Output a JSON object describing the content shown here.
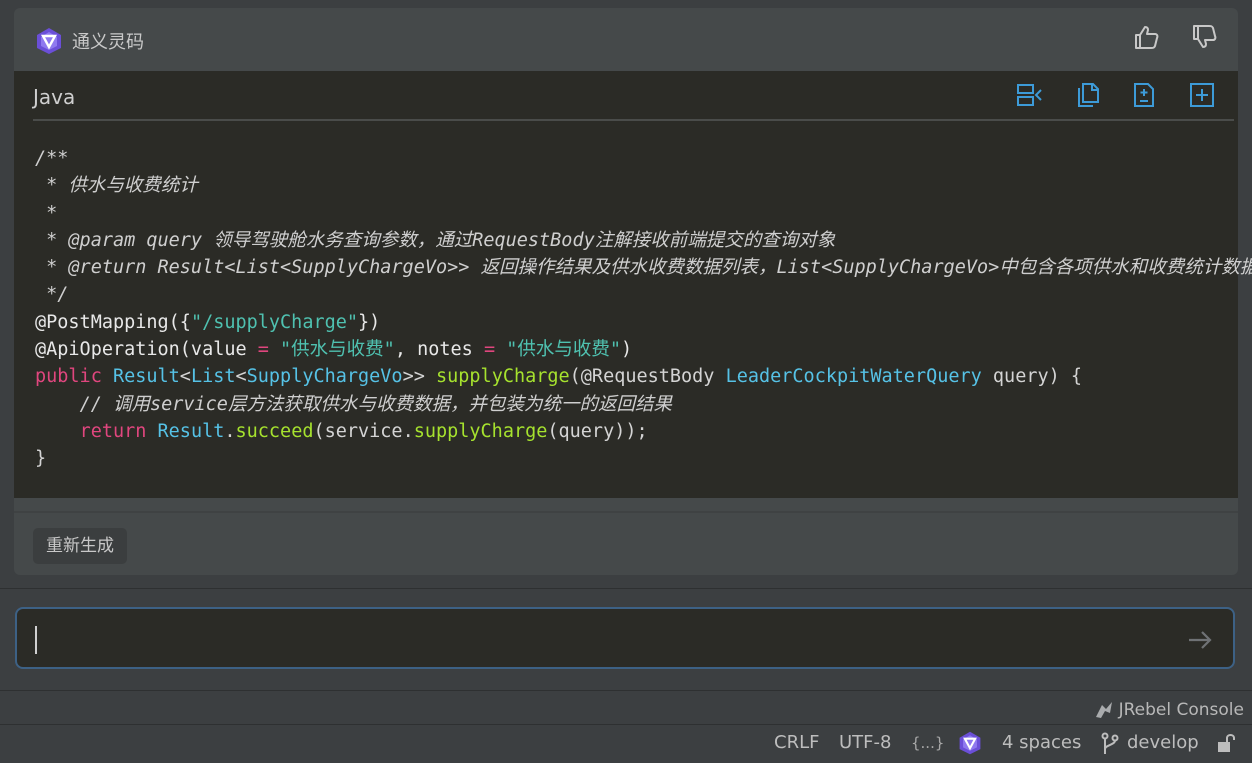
{
  "header": {
    "brand_name": "通义灵码",
    "thumbs_up": "thumbs-up-icon",
    "thumbs_down": "thumbs-down-icon"
  },
  "code_block": {
    "language": "Java",
    "actions": [
      "insert-at-cursor-icon",
      "copy-icon",
      "diff-icon",
      "new-file-icon"
    ]
  },
  "regenerate_label": "重新生成",
  "chat_input": {
    "value": "",
    "send_icon": "send-arrow-icon"
  },
  "jrebel_console": "JRebel Console",
  "status_bar": {
    "line_separator": "CRLF",
    "encoding": "UTF-8",
    "braces": "{...}",
    "indent": "4 spaces",
    "branch": "develop"
  },
  "colors": {
    "accent": "#3d6185",
    "code_bg": "#2b2b26",
    "keyword": "#e0467e",
    "type": "#56c2e6",
    "function": "#a6e22e",
    "string": "#4fc1b0"
  }
}
